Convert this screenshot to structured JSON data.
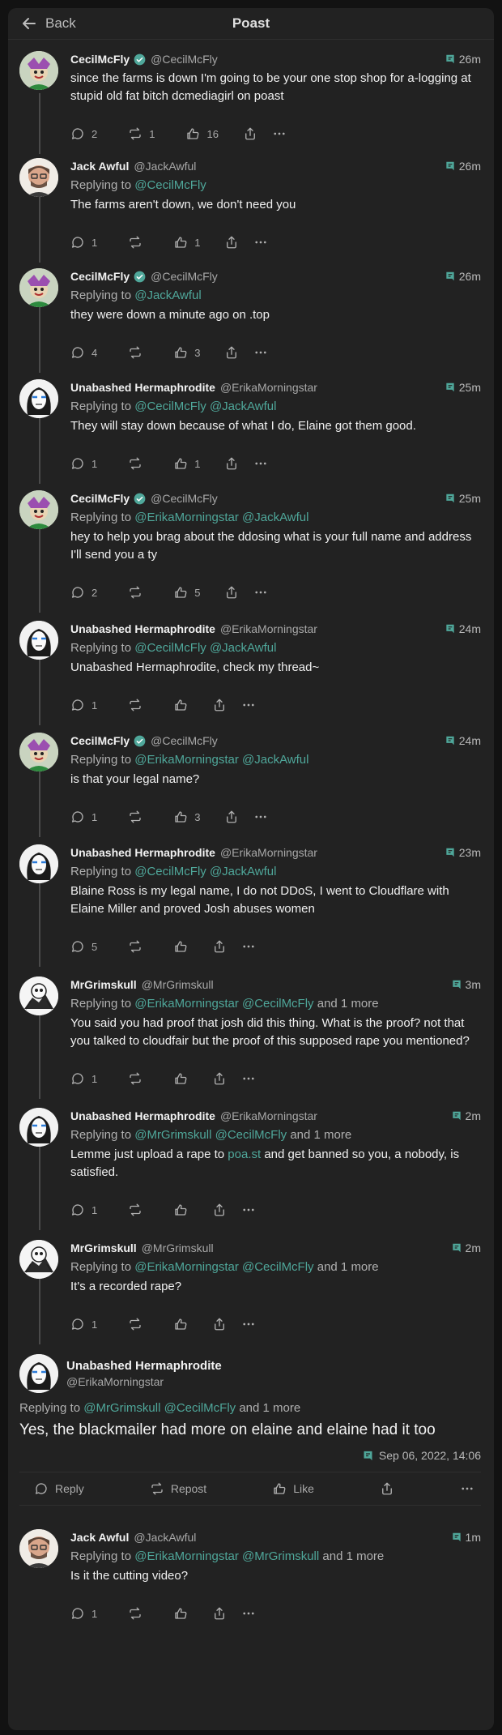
{
  "header": {
    "back_label": "Back",
    "title": "Poast"
  },
  "posts": [
    {
      "name": "CecilMcFly",
      "verified": true,
      "handle": "@CecilMcFly",
      "time": "26m",
      "avatar": "jester",
      "reply_to": [],
      "reply_more": "",
      "text": "since the farms is down I'm going to be your one stop shop for a-logging at stupid old fat bitch dcmediagirl on poast",
      "counts": {
        "reply": "2",
        "repost": "1",
        "like": "16"
      }
    },
    {
      "name": "Jack Awful",
      "verified": false,
      "handle": "@JackAwful",
      "time": "26m",
      "avatar": "man",
      "reply_to": [
        "@CecilMcFly"
      ],
      "reply_more": "",
      "text": "The farms aren't down, we don't need you",
      "counts": {
        "reply": "1",
        "repost": "",
        "like": "1"
      }
    },
    {
      "name": "CecilMcFly",
      "verified": true,
      "handle": "@CecilMcFly",
      "time": "26m",
      "avatar": "jester",
      "reply_to": [
        "@JackAwful"
      ],
      "reply_more": "",
      "text": "they were down a minute ago on .top",
      "counts": {
        "reply": "4",
        "repost": "",
        "like": "3"
      }
    },
    {
      "name": "Unabashed Hermaphrodite",
      "verified": false,
      "handle": "@ErikaMorningstar",
      "time": "25m",
      "avatar": "mask",
      "reply_to": [
        "@CecilMcFly",
        "@JackAwful"
      ],
      "reply_more": "",
      "text": "They will stay down because of what I do, Elaine got them good.",
      "counts": {
        "reply": "1",
        "repost": "",
        "like": "1"
      }
    },
    {
      "name": "CecilMcFly",
      "verified": true,
      "handle": "@CecilMcFly",
      "time": "25m",
      "avatar": "jester",
      "reply_to": [
        "@ErikaMorningstar",
        "@JackAwful"
      ],
      "reply_more": "",
      "text": "hey to help you brag about the ddosing what is your full name and address I'll send you a ty",
      "counts": {
        "reply": "2",
        "repost": "",
        "like": "5"
      }
    },
    {
      "name": "Unabashed Hermaphrodite",
      "verified": false,
      "handle": "@ErikaMorningstar",
      "time": "24m",
      "avatar": "mask",
      "reply_to": [
        "@CecilMcFly",
        "@JackAwful"
      ],
      "reply_more": "",
      "text": "Unabashed Hermaphrodite, check my thread~",
      "counts": {
        "reply": "1",
        "repost": "",
        "like": ""
      }
    },
    {
      "name": "CecilMcFly",
      "verified": true,
      "handle": "@CecilMcFly",
      "time": "24m",
      "avatar": "jester",
      "reply_to": [
        "@ErikaMorningstar",
        "@JackAwful"
      ],
      "reply_more": "",
      "text": "is that your legal name?",
      "counts": {
        "reply": "1",
        "repost": "",
        "like": "3"
      }
    },
    {
      "name": "Unabashed Hermaphrodite",
      "verified": false,
      "handle": "@ErikaMorningstar",
      "time": "23m",
      "avatar": "mask",
      "reply_to": [
        "@CecilMcFly",
        "@JackAwful"
      ],
      "reply_more": "",
      "text": "Blaine Ross is my legal name, I do not DDoS, I went to Cloudflare with Elaine Miller and proved Josh abuses women",
      "counts": {
        "reply": "5",
        "repost": "",
        "like": ""
      }
    },
    {
      "name": "MrGrimskull",
      "verified": false,
      "handle": "@MrGrimskull",
      "time": "3m",
      "avatar": "skull",
      "reply_to": [
        "@ErikaMorningstar",
        "@CecilMcFly"
      ],
      "reply_more": "and 1 more",
      "text": "You said you had proof that josh did this thing. What is the proof? not that you talked to cloudfair but the proof of this supposed rape you mentioned?",
      "counts": {
        "reply": "1",
        "repost": "",
        "like": ""
      }
    },
    {
      "name": "Unabashed Hermaphrodite",
      "verified": false,
      "handle": "@ErikaMorningstar",
      "time": "2m",
      "avatar": "mask",
      "reply_to": [
        "@MrGrimskull",
        "@CecilMcFly"
      ],
      "reply_more": "and 1 more",
      "text_parts": [
        "Lemme just upload a rape to ",
        "poa.st",
        " and get banned so you, a nobody, is satisfied."
      ],
      "counts": {
        "reply": "1",
        "repost": "",
        "like": ""
      }
    },
    {
      "name": "MrGrimskull",
      "verified": false,
      "handle": "@MrGrimskull",
      "time": "2m",
      "avatar": "skull",
      "reply_to": [
        "@ErikaMorningstar",
        "@CecilMcFly"
      ],
      "reply_more": "and 1 more",
      "text": "It's a recorded rape?",
      "counts": {
        "reply": "1",
        "repost": "",
        "like": ""
      }
    }
  ],
  "focused": {
    "name": "Unabashed Hermaphrodite",
    "handle": "@ErikaMorningstar",
    "avatar": "mask",
    "replying_label": "Replying to",
    "reply_to": [
      "@MrGrimskull",
      "@CecilMcFly"
    ],
    "reply_more": "and 1 more",
    "text": "Yes, the blackmailer had more on elaine and elaine had it too",
    "date": "Sep 06, 2022, 14:06",
    "actions": {
      "reply": "Reply",
      "repost": "Repost",
      "like": "Like"
    }
  },
  "replies": [
    {
      "name": "Jack Awful",
      "verified": false,
      "handle": "@JackAwful",
      "time": "1m",
      "avatar": "man",
      "reply_to": [
        "@ErikaMorningstar",
        "@MrGrimskull"
      ],
      "reply_more": "and 1 more",
      "text": "Is it the cutting video?",
      "counts": {
        "reply": "1",
        "repost": "",
        "like": ""
      }
    }
  ],
  "labels": {
    "replying_to": "Replying to"
  },
  "colors": {
    "background": "#222222",
    "mention": "#4fa79a",
    "verified": "#4fa79a",
    "text": "#f0f0f0"
  },
  "icons": [
    "back-arrow-icon",
    "verified-icon",
    "source-icon",
    "reply-icon",
    "repost-icon",
    "like-icon",
    "share-icon",
    "more-icon"
  ]
}
